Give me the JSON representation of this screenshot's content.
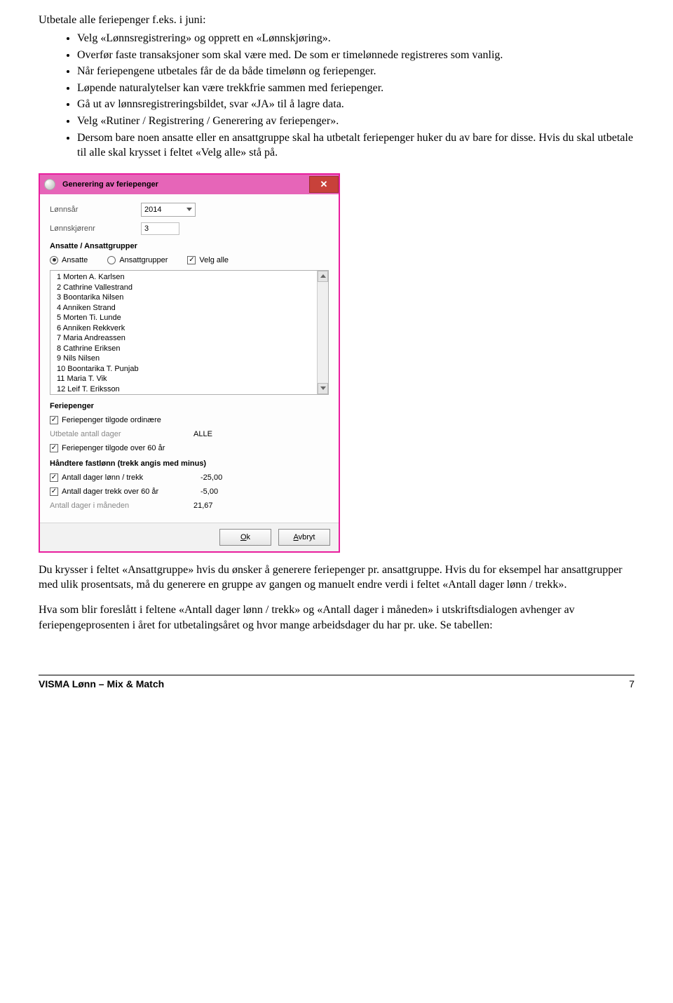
{
  "doc": {
    "heading": "Utbetale alle feriepenger f.eks. i juni:",
    "bullets": [
      "Velg «Lønnsregistrering» og opprett en «Lønnskjøring».",
      "Overfør faste transaksjoner som skal være med. De som er timelønnede registreres som vanlig.",
      "Når feriepengene utbetales får de da både timelønn og feriepenger.",
      "Løpende naturalytelser kan være trekkfrie sammen med feriepenger.",
      "Gå ut av lønnsregistreringsbildet, svar «JA» til å lagre data.",
      "Velg «Rutiner / Registrering / Generering av feriepenger».",
      "Dersom bare noen ansatte eller en ansattgruppe skal ha utbetalt feriepenger huker du av bare for disse. Hvis du skal utbetale til alle skal krysset i feltet «Velg alle» stå på."
    ],
    "para1": "Du krysser i feltet «Ansattgruppe» hvis du ønsker å generere feriepenger pr. ansattgruppe. Hvis du for eksempel har ansattgrupper med ulik prosentsats, må du generere en gruppe av gangen og manuelt endre verdi i feltet «Antall dager lønn / trekk».",
    "para2": "Hva som blir foreslått i feltene «Antall dager lønn / trekk» og «Antall dager i måneden» i utskriftsdialogen avhenger av feriepengeprosenten i året for utbetalingsåret og hvor mange arbeidsdager du har pr. uke. Se tabellen:"
  },
  "dialog": {
    "title": "Generering av feriepenger",
    "year_label": "Lønnsår",
    "year_value": "2014",
    "run_label": "Lønnskjørenr",
    "run_value": "3",
    "section_ansatte": "Ansatte / Ansattgrupper",
    "radio_ansatte": "Ansatte",
    "radio_grupper": "Ansattgrupper",
    "check_velgalle": "Velg alle",
    "employees": [
      "1 Morten A. Karlsen",
      "2 Cathrine Vallestrand",
      "3 Boontarika Nilsen",
      "4 Anniken Strand",
      "5 Morten Ti. Lunde",
      "6 Anniken Rekkverk",
      "7 Maria Andreassen",
      "8 Cathrine Eriksen",
      "9 Nils Nilsen",
      "10 Boontarika T. Punjab",
      "11 Maria T. Vik",
      "12 Leif T. Eriksson"
    ],
    "section_ferie": "Feriepenger",
    "chk_ord": "Feriepenger tilgode ordinære",
    "utbet_label": "Utbetale antall dager",
    "utbet_value": "ALLE",
    "chk_over60": "Feriepenger tilgode over 60 år",
    "section_fastlonn": "Håndtere fastlønn (trekk angis med minus)",
    "chk_antdag": "Antall dager lønn / trekk",
    "val_antdag": "-25,00",
    "chk_over60trekk": "Antall dager trekk over 60 år",
    "val_over60trekk": "-5,00",
    "lbl_mnd": "Antall dager i måneden",
    "val_mnd": "21,67",
    "btn_ok": "Ok",
    "btn_cancel": "Avbryt"
  },
  "footer": {
    "left": "VISMA Lønn – Mix & Match",
    "page": "7"
  }
}
